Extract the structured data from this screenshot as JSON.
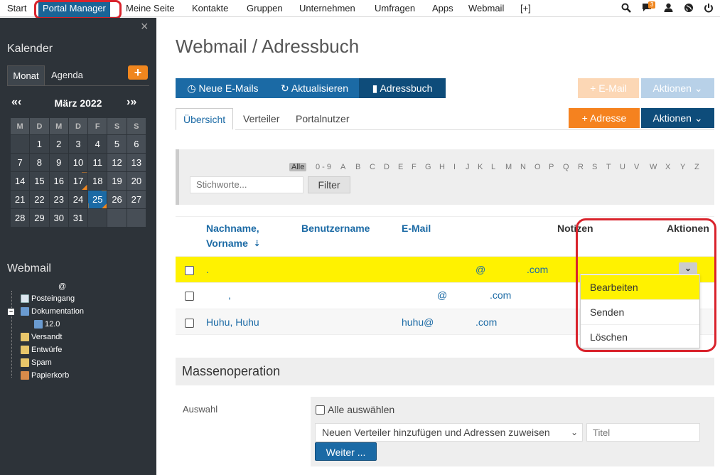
{
  "nav": {
    "items": [
      "Start",
      "Portal Manager",
      "Meine Seite",
      "Kontakte",
      "Gruppen",
      "Unternehmen",
      "Umfragen",
      "Apps",
      "Webmail",
      "[+]"
    ],
    "active": "Portal Manager",
    "notification_count": "3"
  },
  "sidebar": {
    "close": "×",
    "calendar_title": "Kalender",
    "tab_month": "Monat",
    "tab_agenda": "Agenda",
    "add": "+",
    "prev": "«‹",
    "next": "›»",
    "month_label": "März 2022",
    "weekdays": [
      "M",
      "D",
      "M",
      "D",
      "F",
      "S",
      "S"
    ],
    "weeks": [
      [
        "",
        "1",
        "2",
        "3",
        "4",
        "5",
        "6"
      ],
      [
        "7",
        "8",
        "9",
        "10",
        "11",
        "12",
        "13"
      ],
      [
        "14",
        "15",
        "16",
        "17",
        "18",
        "19",
        "20"
      ],
      [
        "21",
        "22",
        "23",
        "24",
        "25",
        "26",
        "27"
      ],
      [
        "28",
        "29",
        "30",
        "31",
        "",
        "",
        ""
      ]
    ],
    "today": "25",
    "webmail_title": "Webmail",
    "account": "@",
    "folders": {
      "inbox": "Posteingang",
      "documentation": "Dokumentation",
      "doc_sub": "12.0",
      "sent": "Versandt",
      "drafts": "Entwürfe",
      "spam": "Spam",
      "trash": "Papierkorb"
    }
  },
  "main": {
    "title": "Webmail / Adressbuch",
    "toolbar": {
      "new_mails": "Neue E-Mails",
      "refresh": "Aktualisieren",
      "addressbook": "Adressbuch",
      "email": "E-Mail",
      "actions": "Aktionen"
    },
    "tabs": [
      "Übersicht",
      "Verteiler",
      "Portalnutzer"
    ],
    "add_address": "Adresse",
    "actions": "Aktionen",
    "alphabet": [
      "Alle",
      "0 - 9",
      "A",
      "B",
      "C",
      "D",
      "E",
      "F",
      "G",
      "H",
      "I",
      "J",
      "K",
      "L",
      "M",
      "N",
      "O",
      "P",
      "Q",
      "R",
      "S",
      "T",
      "U",
      "V",
      "W",
      "X",
      "Y",
      "Z"
    ],
    "search_placeholder": "Stichworte...",
    "filter": "Filter",
    "columns": {
      "name1": "Nachname,",
      "name2": "Vorname",
      "sort": "⇣",
      "username": "Benutzername",
      "email": "E-Mail",
      "notes": "Notizen",
      "actions": "Aktionen"
    },
    "rows": [
      {
        "name": ".",
        "email_user": "@",
        "email_domain": ".com"
      },
      {
        "name": ",",
        "email_user": "@",
        "email_domain": ".com"
      },
      {
        "name": "Huhu, Huhu",
        "email_user": "huhu@",
        "email_domain": ".com"
      }
    ],
    "dropdown": [
      "Bearbeiten",
      "Senden",
      "Löschen"
    ],
    "mass": {
      "title": "Massenoperation",
      "label": "Auswahl",
      "select_all": "Alle auswählen",
      "select_value": "Neuen Verteiler hinzufügen und Adressen zuweisen",
      "title_placeholder": "Titel",
      "next": "Weiter ..."
    }
  },
  "colors": {
    "primary": "#1b6aa5",
    "dark": "#0e4c7a",
    "orange": "#f5821f",
    "highlight": "#fff200",
    "annotation": "#d9232c"
  }
}
